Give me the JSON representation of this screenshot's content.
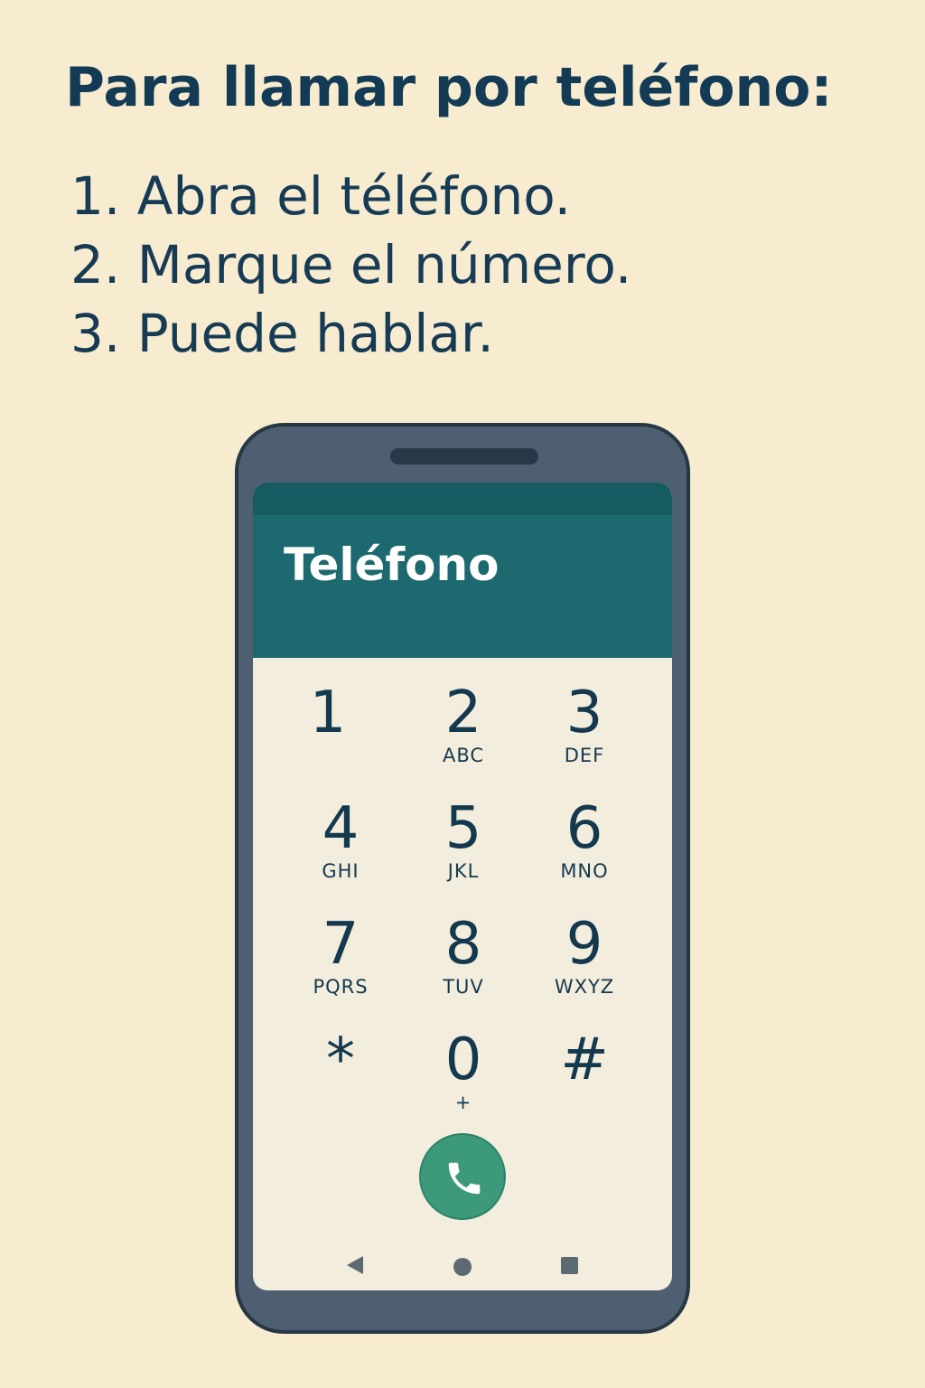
{
  "instructions": {
    "title": "Para llamar por teléfono:",
    "steps": [
      "1. Abra el téléfono.",
      "2. Marque el número.",
      "3. Puede hablar."
    ]
  },
  "phone": {
    "app_title": "Teléfono",
    "keypad": [
      {
        "digit": "1",
        "letters": ""
      },
      {
        "digit": "2",
        "letters": "ABC"
      },
      {
        "digit": "3",
        "letters": "DEF"
      },
      {
        "digit": "4",
        "letters": "GHI"
      },
      {
        "digit": "5",
        "letters": "JKL"
      },
      {
        "digit": "6",
        "letters": "MNO"
      },
      {
        "digit": "7",
        "letters": "PQRS"
      },
      {
        "digit": "8",
        "letters": "TUV"
      },
      {
        "digit": "9",
        "letters": "WXYZ"
      },
      {
        "digit": "*",
        "letters": ""
      },
      {
        "digit": "0",
        "letters": "+"
      },
      {
        "digit": "#",
        "letters": ""
      }
    ],
    "call_icon": "phone-icon",
    "nav_icons": [
      "back-icon",
      "home-icon",
      "recents-icon"
    ]
  },
  "colors": {
    "background": "#f7ecd0",
    "text": "#143b55",
    "header": "#1c6a6f",
    "call_button": "#3c9a7b",
    "phone_body": "#4d5f70"
  }
}
